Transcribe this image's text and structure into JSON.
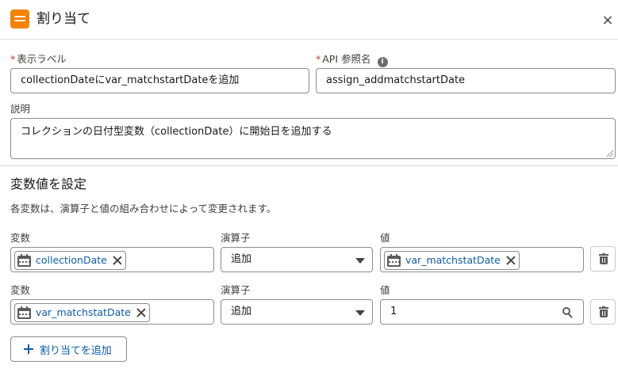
{
  "header": {
    "title": "割り当て",
    "close_glyph": "×",
    "icon": "assignment-icon"
  },
  "form": {
    "label_field": {
      "label": "表示ラベル",
      "required_mark": "*",
      "value": "collectionDateにvar_matchstartDateを追加"
    },
    "api_field": {
      "label": "API 参照名",
      "required_mark": "*",
      "info_glyph": "i",
      "value": "assign_addmatchstartDate"
    },
    "description": {
      "label": "説明",
      "value": "コレクションの日付型変数（collectionDate）に開始日を追加する"
    }
  },
  "section": {
    "title": "変数値を設定",
    "description": "各変数は、演算子と値の組み合わせによって変更されます。"
  },
  "rows": [
    {
      "variable_label": "変数",
      "variable_value": "collectionDate",
      "operator_label": "演算子",
      "operator_value": "追加",
      "value_label": "値",
      "value_value": "var_matchstatDate"
    },
    {
      "variable_label": "変数",
      "variable_value": "var_matchstatDate",
      "operator_label": "演算子",
      "operator_value": "追加",
      "value_label": "値",
      "value_value": "1"
    }
  ],
  "add_button": {
    "label": "割り当てを追加"
  },
  "colors": {
    "accent": "#0b5cab",
    "header_icon": "#f38303",
    "required": "#c23934"
  }
}
